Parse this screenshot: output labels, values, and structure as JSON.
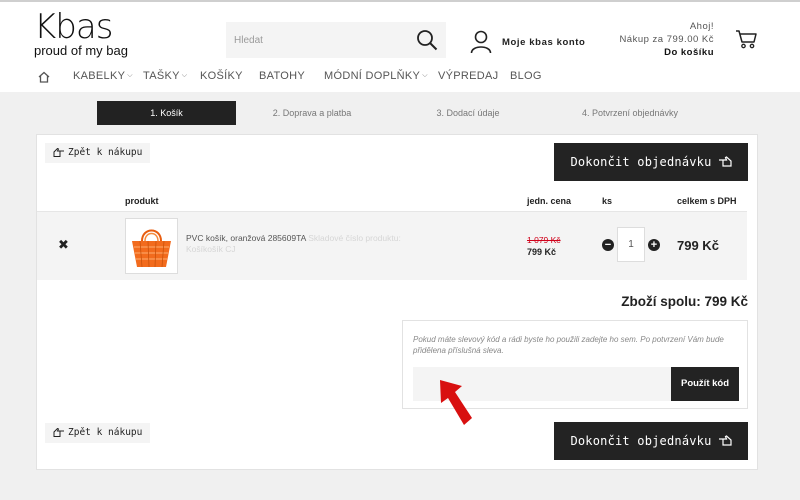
{
  "header": {
    "logo_main": "Kbas",
    "logo_sub": "proud of my bag",
    "search_placeholder": "Hledat",
    "account_label": "Moje kbas konto",
    "cart_greeting": "Ahoj!",
    "cart_summary": "Nákup za 799.00 Kč",
    "cart_link": "Do košíku"
  },
  "nav": [
    "KABELKY",
    "TAŠKY",
    "KOŠÍKY",
    "BATOHY",
    "MÓDNÍ DOPLŇKY",
    "VÝPREDAJ",
    "BLOG"
  ],
  "steps": [
    "1. Košík",
    "2. Doprava a platba",
    "3. Dodací údaje",
    "4. Potvrzení objednávky"
  ],
  "actions": {
    "back_label": "Zpět k nákupu",
    "finish_label": "Dokončit objednávku"
  },
  "table": {
    "headers": {
      "product": "produkt",
      "unit_price": "jedn. cena",
      "qty": "ks",
      "total": "celkem s DPH"
    },
    "rows": [
      {
        "name": "PVC košík, oranžová 285609TA",
        "note": "Skladové číslo produktu: Košíkošík CJ",
        "old_price": "1 079 Kč",
        "price": "799 Kč",
        "qty": "1",
        "total": "799 Kč"
      }
    ]
  },
  "summary": "Zboží spolu: 799 Kč",
  "coupon": {
    "text": "Pokud máte slevový kód a rádi byste ho použili zadejte ho sem. Po potvrzení Vám bude přidělena příslušná sleva.",
    "button": "Použít kód"
  },
  "icons": {
    "home": "home-icon",
    "search": "search-icon",
    "user": "user-icon",
    "cart": "cart-icon",
    "back": "hand-left-icon",
    "finish": "hand-right-icon",
    "arrow": "red-arrow-icon"
  },
  "colors": {
    "dark": "#232323",
    "accent_red": "#d0021b",
    "product_orange": "#f26b1d"
  }
}
